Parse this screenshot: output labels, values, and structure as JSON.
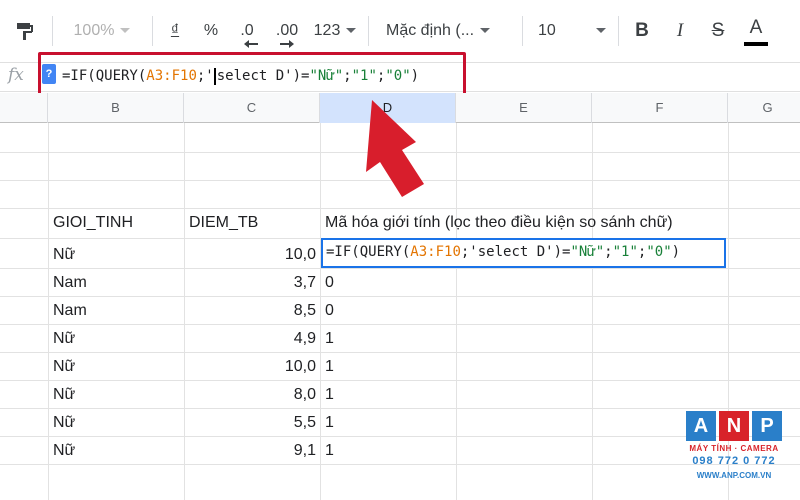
{
  "toolbar": {
    "zoom": "100%",
    "currency": "₫",
    "percent": "%",
    "decrease_decimal": ".0",
    "increase_decimal": ".00",
    "more_formats": "123",
    "font_family": "Mặc định (...",
    "font_size": "10",
    "bold": "B",
    "italic": "I",
    "strikethrough": "S",
    "text_color": "A"
  },
  "formula_bar": {
    "fx_label": "fx",
    "help_label": "?",
    "formula": {
      "p1": "=IF(QUERY(",
      "p2": "A3:F10",
      "p3": ";'",
      "p4": "select D')=",
      "p5": "\"Nữ\"",
      "p6": ";",
      "p7": "\"1\"",
      "p8": ";",
      "p9": "\"0\"",
      "p10": ")"
    }
  },
  "columns": [
    "B",
    "C",
    "D",
    "E",
    "F",
    "G"
  ],
  "headers": {
    "b": "GIOI_TINH",
    "c": "DIEM_TB",
    "d": "Mã hóa giới tính (lọc theo điều kiện so sánh chữ)"
  },
  "rows": [
    {
      "b": "Nữ",
      "c": "10,0",
      "d": ""
    },
    {
      "b": "Nam",
      "c": "3,7",
      "d": "0"
    },
    {
      "b": "Nam",
      "c": "8,5",
      "d": "0"
    },
    {
      "b": "Nữ",
      "c": "4,9",
      "d": "1"
    },
    {
      "b": "Nữ",
      "c": "10,0",
      "d": "1"
    },
    {
      "b": "Nữ",
      "c": "8,0",
      "d": "1"
    },
    {
      "b": "Nữ",
      "c": "5,5",
      "d": "1"
    },
    {
      "b": "Nữ",
      "c": "9,1",
      "d": "1"
    }
  ],
  "active_cell": {
    "formula": {
      "p1": "=IF(QUERY(",
      "p2": "A3:F10",
      "p3": ";'select D')=",
      "p4": "\"Nữ\"",
      "p5": ";",
      "p6": "\"1\"",
      "p7": ";",
      "p8": "\"0\"",
      "p9": ")"
    }
  },
  "logo": {
    "letters": [
      "A",
      "N",
      "P"
    ],
    "subtitle": "MÁY TÍNH · CAMERA",
    "phone": "098 772 0 772",
    "website": "WWW.ANP.COM.VN"
  },
  "colors": {
    "highlight_border": "#c8102e",
    "arrow": "#d81e2c",
    "active_cell_border": "#1a73e8",
    "formula_ref": "#e37400",
    "formula_string": "#188038"
  },
  "icons": {
    "paint_format": "paint-format-icon",
    "arrow": "red-arrow-icon"
  }
}
